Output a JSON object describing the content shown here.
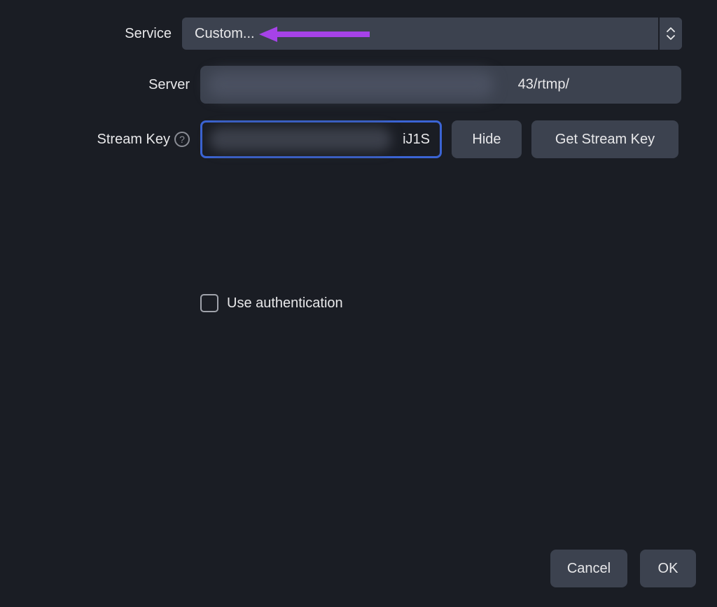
{
  "labels": {
    "service": "Service",
    "server": "Server",
    "stream_key": "Stream Key",
    "help_glyph": "?"
  },
  "service": {
    "selected": "Custom..."
  },
  "server": {
    "visible_suffix": "43/rtmp/"
  },
  "stream_key": {
    "visible_suffix": "iJ1S"
  },
  "buttons": {
    "hide": "Hide",
    "get_stream_key": "Get Stream Key",
    "cancel": "Cancel",
    "ok": "OK"
  },
  "checkbox": {
    "use_auth_label": "Use authentication",
    "checked": false
  },
  "annotation": {
    "arrow_color": "#a642e8"
  }
}
